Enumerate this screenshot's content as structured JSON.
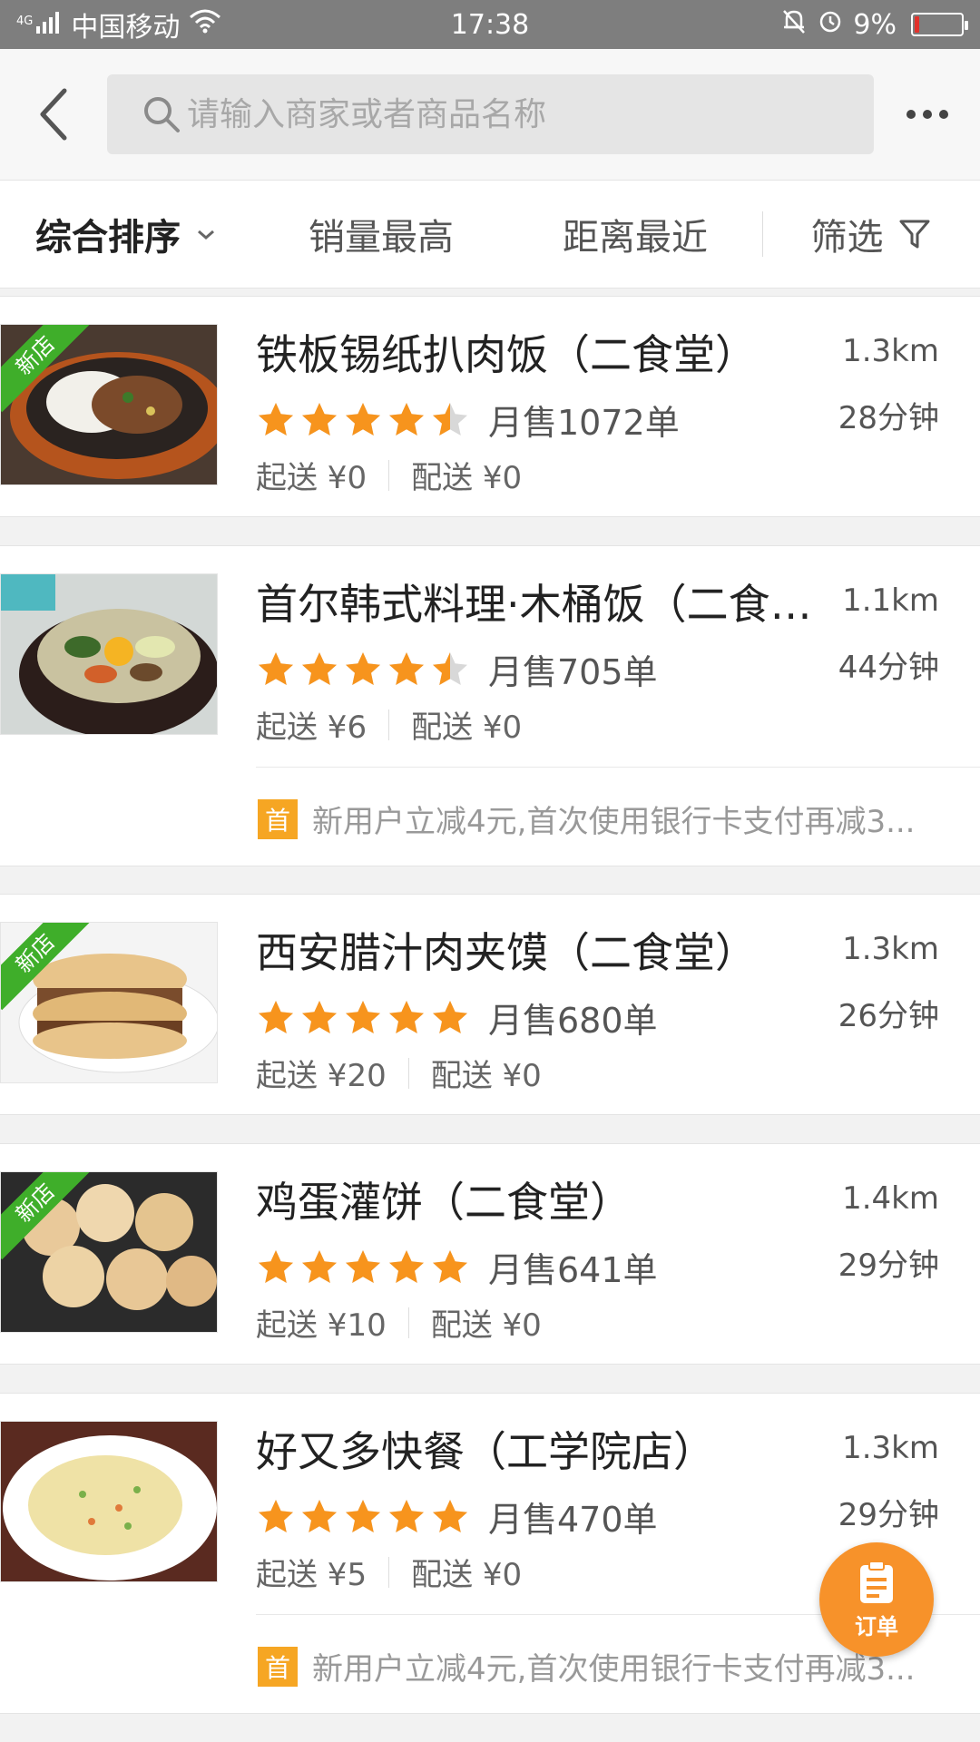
{
  "status_bar": {
    "network": "4G",
    "carrier": "中国移动",
    "time": "17:38",
    "battery": "9%",
    "battery_level": 0.09,
    "colors": {
      "background": "#7e7e7e",
      "battery_low": "#e2322c"
    }
  },
  "header": {
    "back_icon": "chevron-left-icon",
    "search_placeholder": "请输入商家或者商品名称",
    "search_value": "",
    "more_icon": "more-dots-icon"
  },
  "sort_bar": {
    "items": [
      {
        "label": "综合排序",
        "active": true,
        "icon": "chevron-down-icon"
      },
      {
        "label": "销量最高",
        "active": false
      },
      {
        "label": "距离最近",
        "active": false
      },
      {
        "label": "筛选",
        "active": false,
        "icon": "filter-icon"
      }
    ]
  },
  "shops": [
    {
      "name": "铁板锡纸扒肉饭（二食堂）",
      "distance": "1.3km",
      "rating": 4.5,
      "sales": "月售1072单",
      "eta": "28分钟",
      "min_order": "起送 ¥0",
      "delivery_fee": "配送 ¥0",
      "new_tag": "新店",
      "promo": null
    },
    {
      "name": "首尔韩式料理·木桶饭（二食…",
      "distance": "1.1km",
      "rating": 4.5,
      "sales": "月售705单",
      "eta": "44分钟",
      "min_order": "起送 ¥6",
      "delivery_fee": "配送 ¥0",
      "new_tag": null,
      "promo": {
        "badge": "首",
        "text": "新用户立减4元,首次使用银行卡支付再减3..."
      }
    },
    {
      "name": "西安腊汁肉夹馍（二食堂）",
      "distance": "1.3km",
      "rating": 5,
      "sales": "月售680单",
      "eta": "26分钟",
      "min_order": "起送 ¥20",
      "delivery_fee": "配送 ¥0",
      "new_tag": "新店",
      "promo": null
    },
    {
      "name": "鸡蛋灌饼（二食堂）",
      "distance": "1.4km",
      "rating": 5,
      "sales": "月售641单",
      "eta": "29分钟",
      "min_order": "起送 ¥10",
      "delivery_fee": "配送 ¥0",
      "new_tag": "新店",
      "promo": null
    },
    {
      "name": "好又多快餐（工学院店）",
      "distance": "1.3km",
      "rating": 5,
      "sales": "月售470单",
      "eta": "29分钟",
      "min_order": "起送 ¥5",
      "delivery_fee": "配送 ¥0",
      "new_tag": null,
      "promo": {
        "badge": "首",
        "text": "新用户立减4元,首次使用银行卡支付再减3..."
      }
    }
  ],
  "order_fab": {
    "label": "订单",
    "icon": "clipboard-icon"
  },
  "colors": {
    "star": "#f7941d",
    "star_empty": "#d8d8d8",
    "promo_badge": "#f6a623",
    "new_tag": "#3fae2a",
    "fab": "#f7922a"
  }
}
